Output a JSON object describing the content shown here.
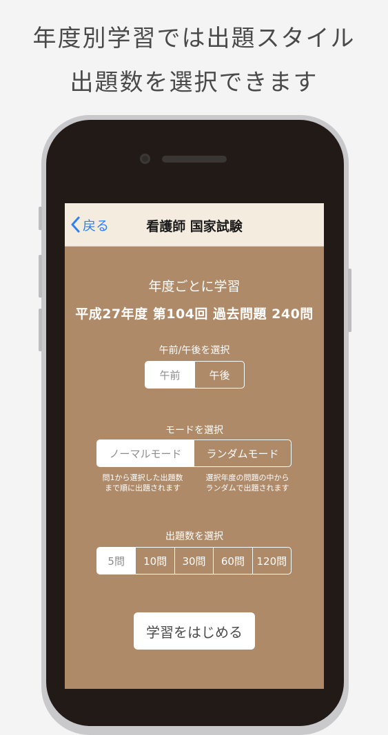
{
  "headline": {
    "line1": "年度別学習では出題スタイル",
    "line2": "出題数を選択できます"
  },
  "navbar": {
    "back_label": "戻る",
    "title": "看護師 国家試験"
  },
  "study": {
    "heading": "年度ごとに学習",
    "exam_info": "平成27年度 第104回 過去問題 240問"
  },
  "session_select": {
    "label": "午前/午後を選択",
    "options": [
      "午前",
      "午後"
    ],
    "selected": "午前"
  },
  "mode_select": {
    "label": "モードを選択",
    "options": [
      "ノーマルモード",
      "ランダムモード"
    ],
    "selected": "ノーマルモード",
    "notes": [
      "問1から選択した出題数\nまで順に出題されます",
      "選択年度の問題の中から\nランダムで出題されます"
    ]
  },
  "count_select": {
    "label": "出題数を選択",
    "options": [
      "5問",
      "10問",
      "30問",
      "60問",
      "120問"
    ],
    "selected": "5問"
  },
  "start_label": "学習をはじめる",
  "colors": {
    "screen_bg": "#ae8a69",
    "navbar_bg": "#f4ecdf",
    "accent_blue": "#2f7ef6"
  }
}
